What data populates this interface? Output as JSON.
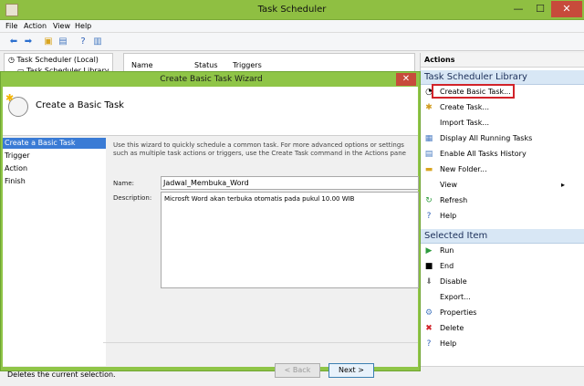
{
  "window": {
    "title": "Task Scheduler",
    "min_glyph": "—",
    "max_glyph": "☐",
    "close_glyph": "✕"
  },
  "menu": {
    "file": "File",
    "action": "Action",
    "view": "View",
    "help": "Help"
  },
  "tree": {
    "root": "Task Scheduler (Local)",
    "child": "Task Scheduler Library"
  },
  "table": {
    "columns": [
      "Name",
      "Status",
      "Triggers"
    ]
  },
  "actions": {
    "header": "Actions",
    "library_section": "Task Scheduler Library",
    "library_items": [
      "Create Basic Task...",
      "Create Task...",
      "Import Task...",
      "Display All Running Tasks",
      "Enable All Tasks History",
      "New Folder...",
      "View",
      "Refresh",
      "Help"
    ],
    "selected_section": "Selected Item",
    "selected_items": [
      "Run",
      "End",
      "Disable",
      "Export...",
      "Properties",
      "Delete",
      "Help"
    ]
  },
  "status": {
    "text": "Deletes the current selection."
  },
  "wizard": {
    "title": "Create Basic Task Wizard",
    "heading": "Create a Basic Task",
    "close_glyph": "✕",
    "steps": [
      "Create a Basic Task",
      "Trigger",
      "Action",
      "Finish"
    ],
    "description": "Use this wizard to quickly schedule a common task.  For more advanced options or settings such as multiple task actions or triggers, use the Create Task command in the Actions pane",
    "name_label": "Name:",
    "name_value": "Jadwal_Membuka_Word",
    "desc_label": "Description:",
    "desc_value": "Microsft Word akan terbuka otomatis pada pukul 10.00 WIB",
    "back_label": "< Back",
    "next_label": "Next >"
  },
  "colors": {
    "title_bar": "#8fbf42",
    "section_header": "#d8e7f5",
    "selected_step": "#3a7bd5",
    "highlight_box": "#d1232a"
  }
}
